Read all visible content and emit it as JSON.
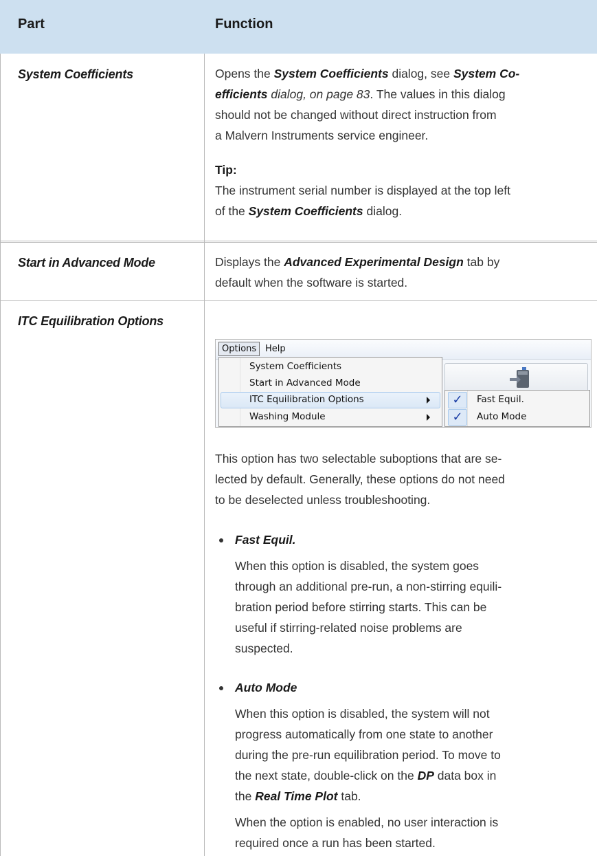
{
  "header": {
    "col_part": "Part",
    "col_function": "Function"
  },
  "rows": [
    {
      "part": "System Coefficients",
      "p1_a": "Opens the ",
      "p1_b": "System Coefficients",
      "p1_c": " dialog, see ",
      "p1_d": "System Co-",
      "p1_line2_a": "efficients",
      "p1_line2_b": " dialog, on page 83",
      "p1_line2_c": ". The values in this dialog",
      "p1_line3": "should not be changed without direct instruction from",
      "p1_line4": "a Malvern Instruments service engineer.",
      "tip_label": "Tip:",
      "tip_line1": "The instrument serial number is displayed at the top left",
      "tip_line2_a": "of the ",
      "tip_line2_b": "System Coefficients",
      "tip_line2_c": " dialog."
    },
    {
      "part": "Start in Advanced Mode",
      "line1_a": "Displays the ",
      "line1_b": "Advanced Experimental Design",
      "line1_c": " tab by",
      "line2": "default when the software is started."
    },
    {
      "part": "ITC Equilibration Options",
      "intro1": "This option has two selectable suboptions that are se-",
      "intro2": "lected by default. Generally, these options do not need",
      "intro3": "to be deselected unless troubleshooting.",
      "b1_title": "Fast Equil.",
      "b1_l1": "When this option is disabled, the system goes",
      "b1_l2": "through an additional pre-run, a non-stirring equili-",
      "b1_l3": "bration period before stirring starts. This can be",
      "b1_l4": "useful if stirring-related noise problems are",
      "b1_l5": "suspected.",
      "b2_title": "Auto Mode",
      "b2_l1": "When this option is disabled, the system will not",
      "b2_l2": "progress automatically from one state to another",
      "b2_l3": "during the pre-run equilibration period. To move to",
      "b2_l4_a": "the next state, double-click on the ",
      "b2_l4_b": "DP",
      "b2_l4_c": " data box in",
      "b2_l5_a": "the ",
      "b2_l5_b": "Real Time Plot",
      "b2_l5_c": " tab.",
      "b2_l6": "When the option is enabled, no user interaction is",
      "b2_l7": "required once a run has been started."
    }
  ],
  "menu": {
    "options": "Options",
    "help": "Help",
    "items": [
      "System Coefficients",
      "Start in Advanced Mode",
      "ITC Equilibration Options",
      "Washing Module"
    ],
    "sub_items": [
      "Fast Equil.",
      "Auto Mode"
    ],
    "check": "✓"
  }
}
